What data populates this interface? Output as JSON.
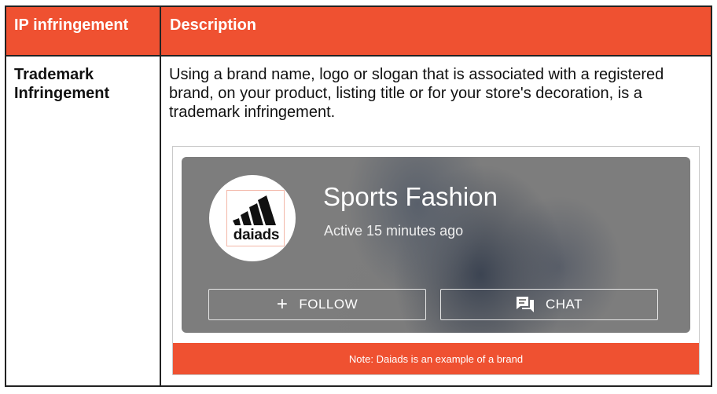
{
  "table": {
    "headers": [
      "IP infringement",
      "Description"
    ],
    "rows": [
      {
        "term": "Trademark Infringement",
        "description": "Using a brand name, logo or slogan that is associated with a registered brand, on your product, listing title or for your store's decoration, is a trademark infringement."
      }
    ]
  },
  "example": {
    "logo_text": "daiads",
    "store_name": "Sports Fashion",
    "status": "Active 15 minutes ago",
    "follow_label": "FOLLOW",
    "chat_label": "CHAT",
    "note": "Note: Daiads is an example of a brand",
    "icons": {
      "follow": "plus-icon",
      "chat": "chat-bubble-icon",
      "logo": "three-stripes-logo-icon"
    }
  },
  "colors": {
    "accent": "#ef5131",
    "card_overlay": "#7d7d7d",
    "border": "#222222"
  }
}
